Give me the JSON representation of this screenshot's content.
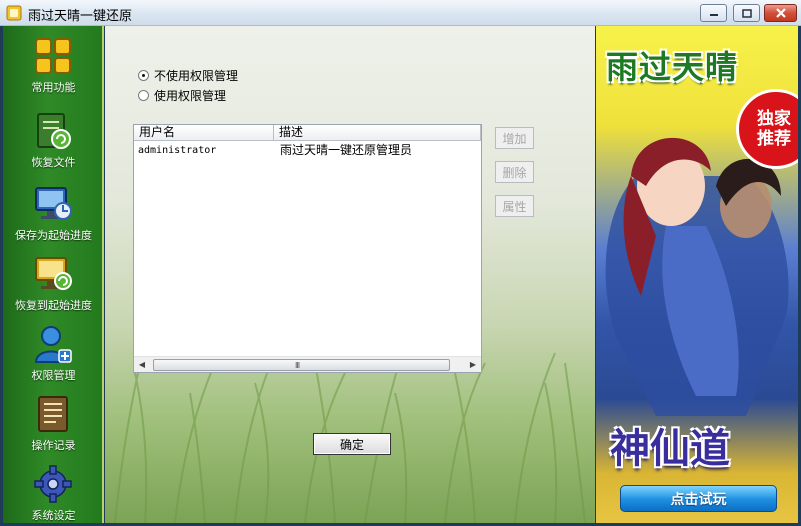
{
  "window": {
    "title": "雨过天晴一键还原",
    "app_icon": "app-icon",
    "controls": [
      "minimize-icon",
      "maximize-icon",
      "close-icon"
    ]
  },
  "sidebar": {
    "items": [
      {
        "label": "常用功能",
        "icon": "grid-icon"
      },
      {
        "label": "恢复文件",
        "icon": "restore-file-icon"
      },
      {
        "label": "保存为起始进度",
        "icon": "save-progress-icon"
      },
      {
        "label": "恢复到起始进度",
        "icon": "restore-progress-icon"
      },
      {
        "label": "权限管理",
        "icon": "user-permission-icon"
      },
      {
        "label": "操作记录",
        "icon": "log-book-icon"
      },
      {
        "label": "系统设定",
        "icon": "gear-icon"
      }
    ]
  },
  "permission": {
    "options": [
      {
        "label": "不使用权限管理",
        "checked": true
      },
      {
        "label": "使用权限管理",
        "checked": false
      }
    ],
    "columns": [
      "用户名",
      "描述"
    ],
    "rows": [
      {
        "username": "administrator",
        "description": "雨过天晴一键还原管理员"
      }
    ],
    "scroll_grip": "III",
    "buttons": {
      "add": "增加",
      "delete": "删除",
      "properties": "属性"
    },
    "ok": "确定"
  },
  "ad": {
    "title": "雨过天晴",
    "badge": [
      "独家",
      "推荐"
    ],
    "logo": "神仙道",
    "cta": "点击试玩"
  },
  "colors": {
    "sidebar_green": "#2f8a26",
    "frame_navy": "#1e3c58",
    "ad_title_green": "#1d7a22",
    "cta_blue": "#1c8fe0"
  }
}
